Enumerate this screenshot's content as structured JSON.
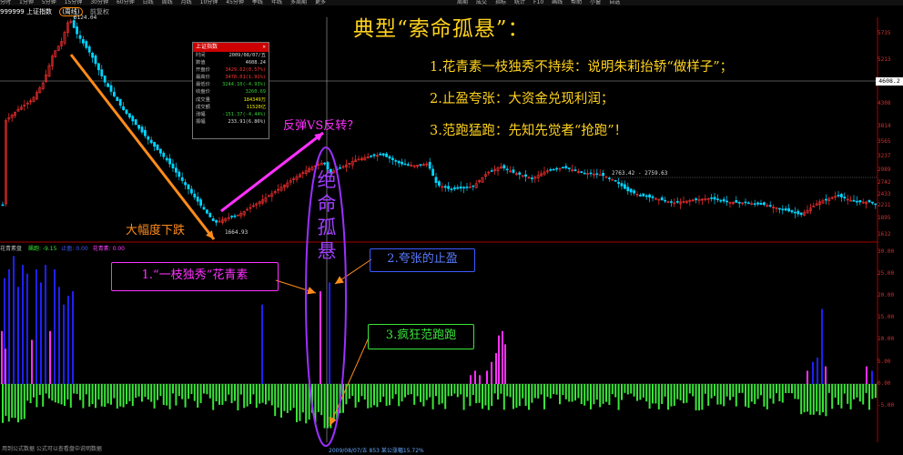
{
  "menubar": {
    "items": [
      "分时",
      "1分钟",
      "5分钟",
      "15分钟",
      "30分钟",
      "60分钟",
      "日线",
      "周线",
      "月线",
      "10分钟",
      "45分钟",
      "季线",
      "年线",
      "多周期",
      "更多",
      "",
      "",
      "",
      "",
      "",
      "",
      "",
      "",
      "",
      "",
      "",
      "",
      "",
      "",
      "",
      "周期",
      "成交",
      "指标",
      "统计",
      "F10",
      "画线",
      "帮助",
      "小窗",
      "自选"
    ]
  },
  "chart_header": {
    "code": "999999 上证指数",
    "period": "(周线)",
    "mode": "前复权",
    "peak_label": "6124.04"
  },
  "right_axis_upper": [
    "5735",
    "5213",
    "4608.2",
    "4308",
    "3814",
    "3565",
    "3237",
    "2989",
    "2742",
    "2433",
    "2211",
    "1895",
    "1612"
  ],
  "current_price": "4608.2",
  "right_axis_lower": [
    "30.00",
    "25.00",
    "20.00",
    "15.00",
    "10.00",
    "5.00",
    "0.00",
    "-5.00"
  ],
  "info_panel": {
    "title": "上证指数",
    "rows": [
      {
        "k": "时间",
        "v": "2009/08/07/五",
        "c": "white"
      },
      {
        "k": "数值",
        "v": "4608.24",
        "c": "white"
      },
      {
        "k": "开盘价",
        "v": "3429.62(0.57%)",
        "c": "red"
      },
      {
        "k": "最高价",
        "v": "3478.01(1.91%)",
        "c": "red"
      },
      {
        "k": "最低价",
        "v": "3244.10(-4.93%)",
        "c": "green"
      },
      {
        "k": "收盘价",
        "v": "3260.69",
        "c": "green"
      },
      {
        "k": "成交量",
        "v": "184349万",
        "c": "yellow"
      },
      {
        "k": "成交额",
        "v": "11520亿",
        "c": "yellow"
      },
      {
        "k": "涨幅",
        "v": "-151.37(-4.44%)",
        "c": "green"
      },
      {
        "k": "振幅",
        "v": "233.91(6.86%)",
        "c": "white"
      }
    ]
  },
  "title": "典型“索命孤悬”：",
  "points": [
    "1.花青素一枝独秀不持续：说明朱莉抬轿“做样子”；",
    "2.止盈夸张：大资金兑现利润；",
    "3.范跑猛跑：先知先觉者“抢跑”！"
  ],
  "labels": {
    "rebound": "反弹VS反转？",
    "decline": "大幅度下跌",
    "low_price": "1664.93",
    "mid_price": "2763.42 - 2759.63",
    "vertical": "绝命孤悬",
    "box1": "1.“一枝独秀”花青素",
    "box2": "2.夸张的止盈",
    "box3": "3.疯狂范跑跑"
  },
  "lower_indicator": {
    "name": "花青素盘",
    "items": [
      {
        "text": "飙跑: -9.15",
        "color": "#39e639"
      },
      {
        "text": "止盈: 0.00",
        "color": "#3b5bff"
      },
      {
        "text": "花青素: 0.00",
        "color": "#ff3cff"
      }
    ]
  },
  "bottombar": {
    "left": "用到公式数据 公式可以查看盘中说明数据",
    "date": "2009/08/07/五 853 某公涨幅15.72%"
  },
  "colors": {
    "up": "#ff3030",
    "down": "#00d5ff",
    "arrow": "#ff8c1a",
    "magenta": "#ff30ff",
    "title": "#ffd21e",
    "green": "#39e639",
    "blue": "#2020ff",
    "pink": "#ff30ff"
  }
}
